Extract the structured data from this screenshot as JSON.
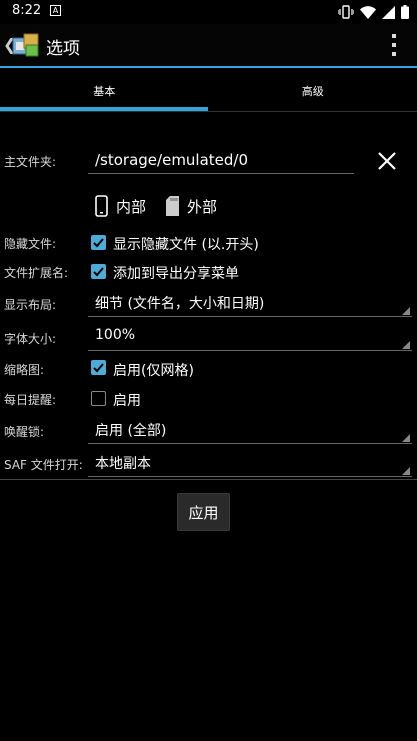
{
  "status_bar": {
    "time": "8:22",
    "notification_glyph": "A",
    "icons": [
      "vibrate-icon",
      "wifi-icon",
      "signal-icon",
      "battery-icon"
    ]
  },
  "action_bar": {
    "title": "选项",
    "accent_color": "#34a5d8"
  },
  "tabs": [
    {
      "label": "基本",
      "selected": true
    },
    {
      "label": "高级",
      "selected": false
    }
  ],
  "settings": {
    "main_folder": {
      "label": "主文件夹:",
      "value": "/storage/emulated/0"
    },
    "storage": {
      "internal_label": "内部",
      "external_label": "外部"
    },
    "hidden_files": {
      "label": "隐藏文件:",
      "checkbox_label": "显示隐藏文件 (以.开头)",
      "checked": true
    },
    "file_ext": {
      "label": "文件扩展名:",
      "checkbox_label": "添加到导出分享菜单",
      "checked": true
    },
    "display_layout": {
      "label": "显示布局:",
      "value": "细节 (文件名，大小和日期)"
    },
    "font_size": {
      "label": "字体大小:",
      "value": "100%"
    },
    "thumbnails": {
      "label": "缩略图:",
      "checkbox_label": "启用(仅网格)",
      "checked": true
    },
    "daily_reminder": {
      "label": "每日提醒:",
      "checkbox_label": "启用",
      "checked": false
    },
    "wake_lock": {
      "label": "唤醒锁:",
      "value": "启用 (全部)"
    },
    "saf_open": {
      "label": "SAF 文件打开:",
      "value": "本地副本"
    }
  },
  "apply_button": {
    "label": "应用"
  }
}
